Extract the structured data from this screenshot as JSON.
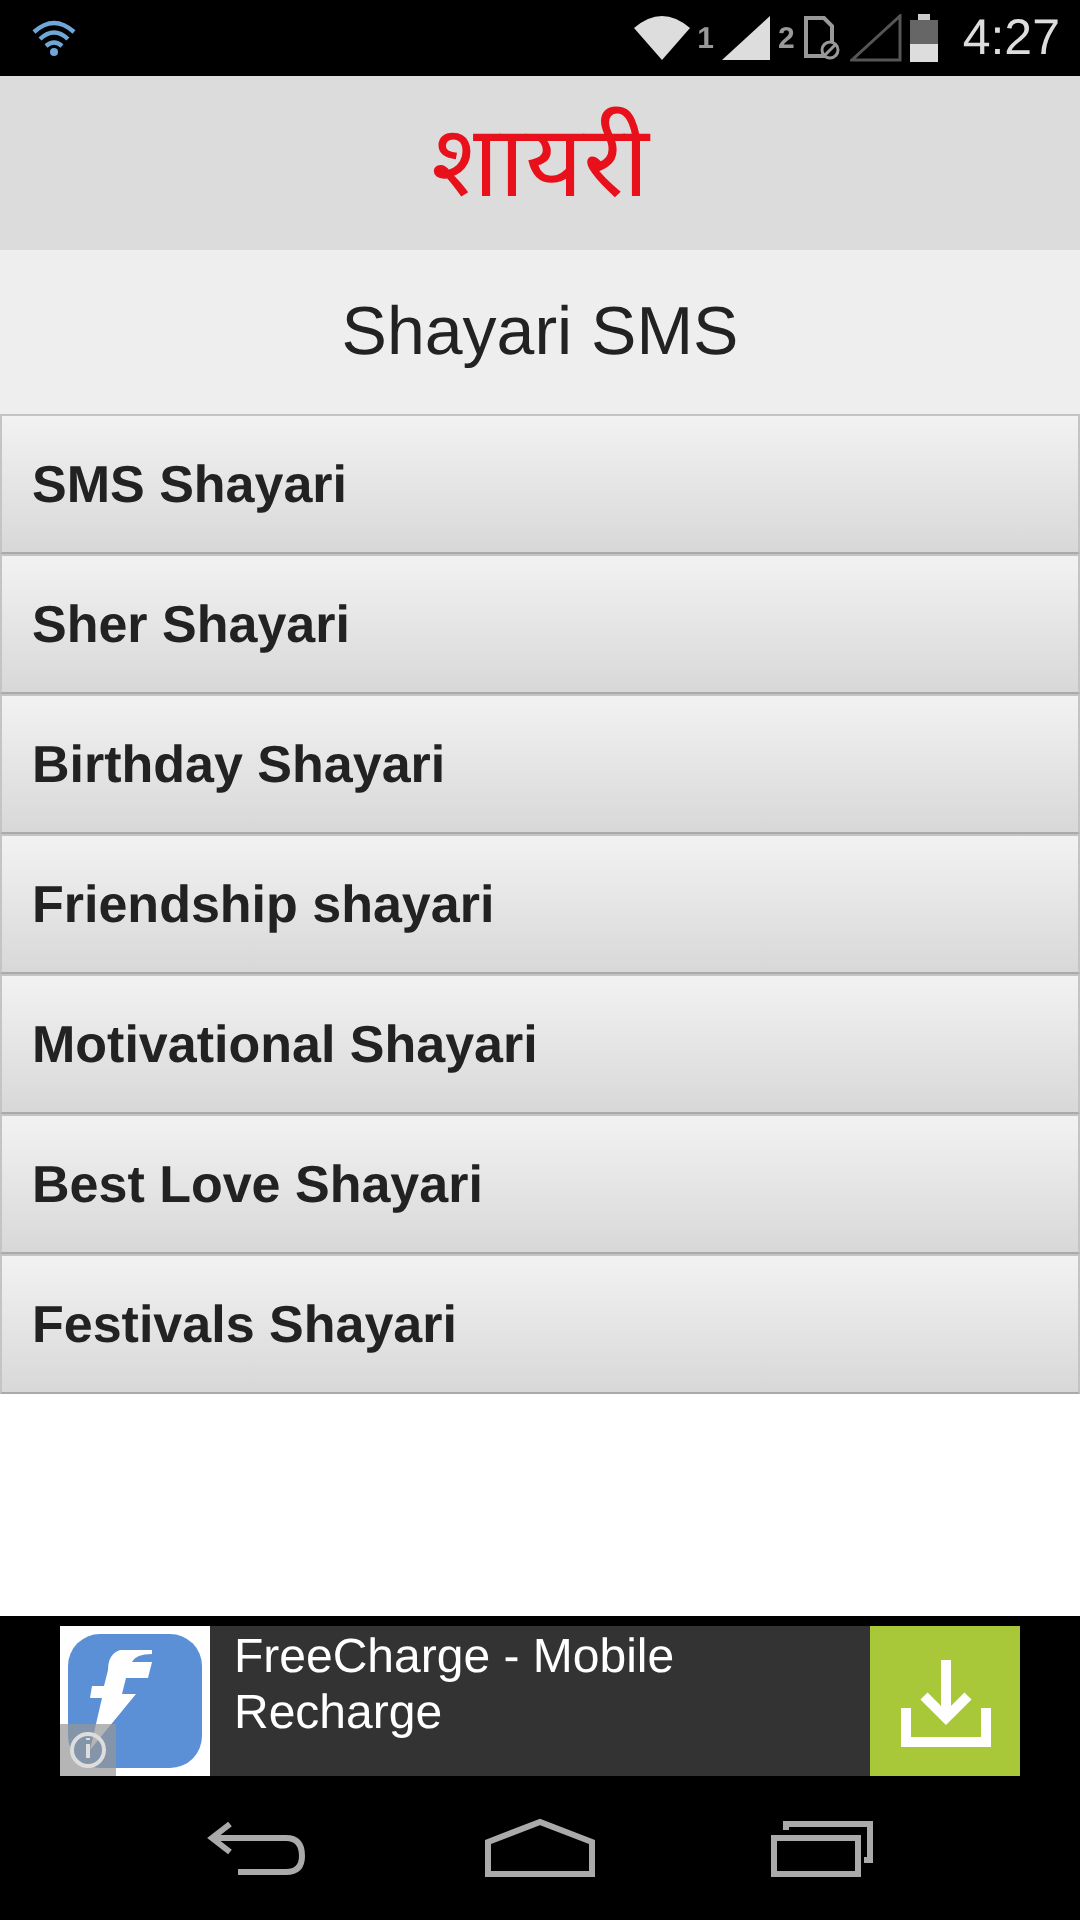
{
  "status_bar": {
    "sim1_label": "1",
    "sim2_label": "2",
    "time": "4:27"
  },
  "header": {
    "logo": "शायरी"
  },
  "page_title": "Shayari SMS",
  "menu_items": [
    {
      "label": "SMS Shayari"
    },
    {
      "label": "Sher Shayari"
    },
    {
      "label": "Birthday Shayari"
    },
    {
      "label": "Friendship shayari"
    },
    {
      "label": "Motivational Shayari"
    },
    {
      "label": "Best Love Shayari"
    },
    {
      "label": "Festivals Shayari"
    }
  ],
  "ad": {
    "title": "FreeCharge - Mobile Recharge"
  }
}
